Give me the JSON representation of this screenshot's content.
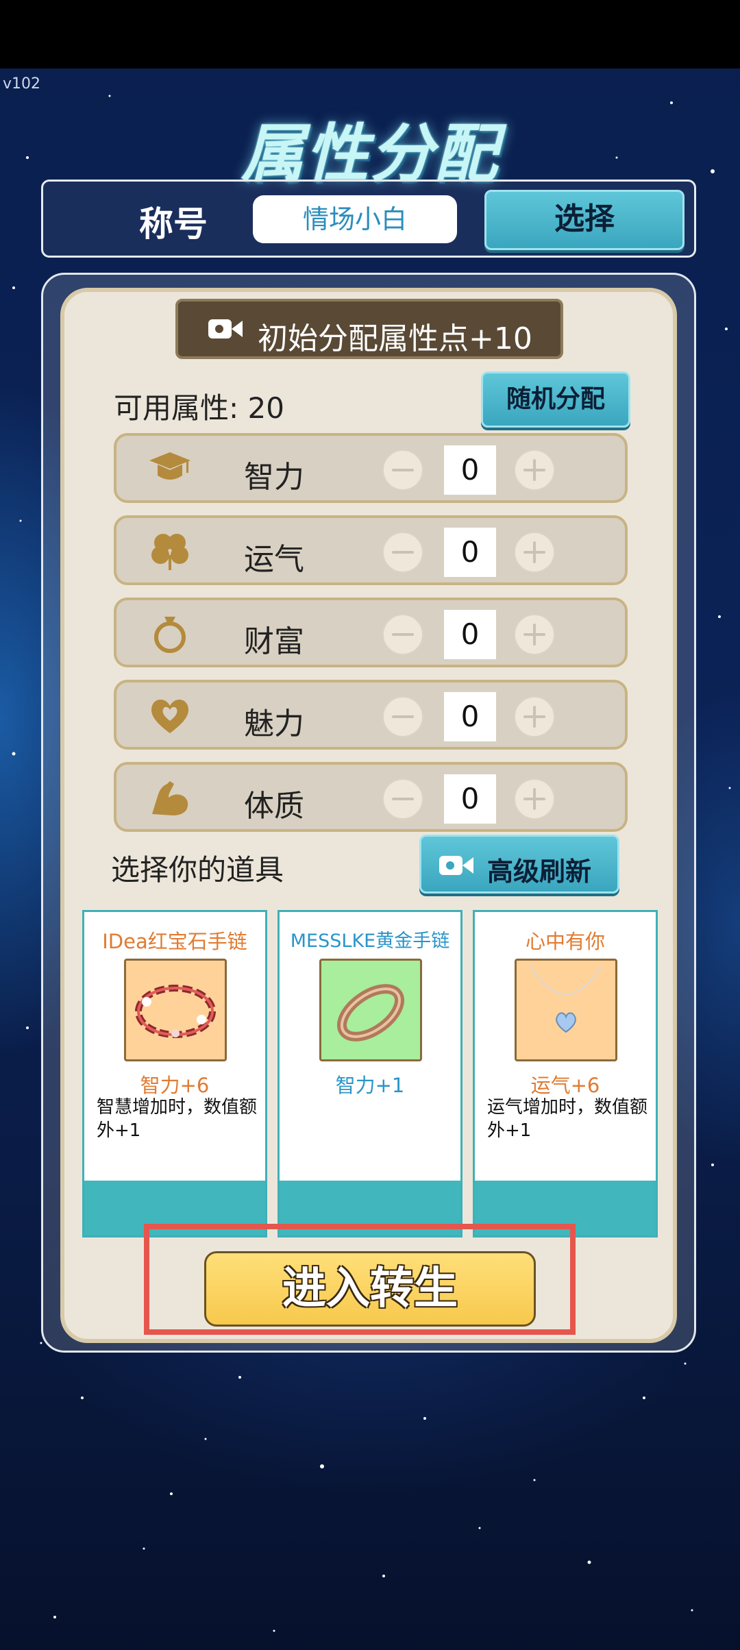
{
  "version": "v102",
  "title": "属性分配",
  "title_row": {
    "label": "称号",
    "value": "情场小白",
    "select_button": "选择"
  },
  "video_banner": {
    "label": "初始分配属性点+10",
    "icon": "video-camera-icon"
  },
  "available": {
    "label": "可用属性: 20"
  },
  "random_button": "随机分配",
  "attributes": [
    {
      "name": "智力",
      "value": "0",
      "icon": "graduation-cap-icon"
    },
    {
      "name": "运气",
      "value": "0",
      "icon": "clover-icon"
    },
    {
      "name": "财富",
      "value": "0",
      "icon": "ring-icon"
    },
    {
      "name": "魅力",
      "value": "0",
      "icon": "heart-icon"
    },
    {
      "name": "体质",
      "value": "0",
      "icon": "muscle-arm-icon"
    }
  ],
  "props": {
    "label": "选择你的道具",
    "refresh_button": "高级刷新",
    "items": [
      {
        "name": "IDea红宝石手链",
        "effect": "智力+6",
        "desc": "智慧增加时，数值额外+1",
        "name_color": "#e07b32",
        "effect_color": "#e07b32",
        "image_bg": "#ffd29a",
        "image": "ruby-bracelet-image"
      },
      {
        "name": "MESSLKE黄金手链",
        "effect": "智力+1",
        "desc": "",
        "name_color": "#2a95c9",
        "effect_color": "#2a95c9",
        "image_bg": "#a8ee9c",
        "image": "gold-bangle-image"
      },
      {
        "name": "心中有你",
        "effect": "运气+6",
        "desc": "运气增加时，数值额外+1",
        "name_color": "#e07b32",
        "effect_color": "#e07b32",
        "image_bg": "#ffd29a",
        "image": "heart-necklace-image"
      }
    ]
  },
  "enter_button": "进入转生",
  "colors": {
    "accent_teal": "#41b6bc",
    "panel_bg": "#ece6da",
    "gold": "#c39a4a",
    "highlight_red": "#e5564d"
  }
}
